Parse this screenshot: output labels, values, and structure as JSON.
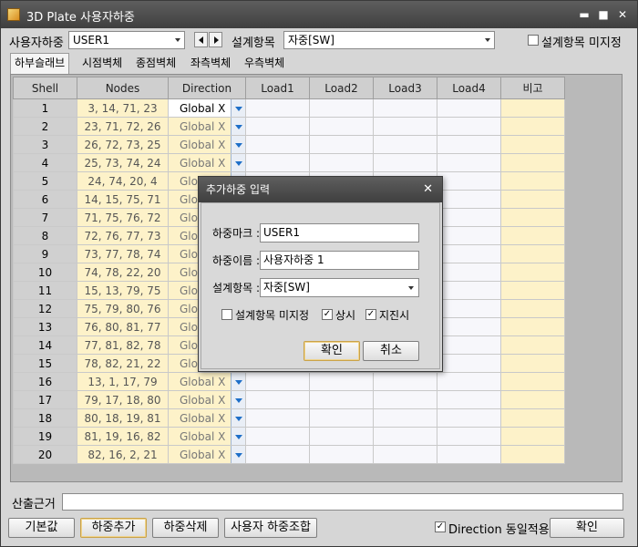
{
  "window": {
    "title": "3D Plate 사용자하중",
    "minimize": "▬",
    "maximize": "■",
    "close": "✕"
  },
  "toolbar": {
    "user_load_label": "사용자하중",
    "user_load_value": "USER1",
    "design_item_label": "설계항목",
    "design_item_value": "자중[SW]",
    "not_specified_label": "설계항목 미지정",
    "not_specified_checked": false
  },
  "tabs": [
    "하부슬래브",
    "시점벽체",
    "종점벽체",
    "좌측벽체",
    "우측벽체"
  ],
  "grid": {
    "columns": [
      "Shell",
      "Nodes",
      "Direction",
      "Load1",
      "Load2",
      "Load3",
      "Load4",
      "비고"
    ],
    "rows": [
      {
        "shell": "1",
        "nodes": "3, 14, 71, 23",
        "direction": "Global X"
      },
      {
        "shell": "2",
        "nodes": "23, 71, 72, 26",
        "direction": "Global X"
      },
      {
        "shell": "3",
        "nodes": "26, 72, 73, 25",
        "direction": "Global X"
      },
      {
        "shell": "4",
        "nodes": "25, 73, 74, 24",
        "direction": "Global X"
      },
      {
        "shell": "5",
        "nodes": "24, 74, 20,  4",
        "direction": "Glob"
      },
      {
        "shell": "6",
        "nodes": "14, 15, 75, 71",
        "direction": "Glob"
      },
      {
        "shell": "7",
        "nodes": "71, 75, 76, 72",
        "direction": "Glob"
      },
      {
        "shell": "8",
        "nodes": "72, 76, 77, 73",
        "direction": "Glob"
      },
      {
        "shell": "9",
        "nodes": "73, 77, 78, 74",
        "direction": "Glob"
      },
      {
        "shell": "10",
        "nodes": "74, 78, 22, 20",
        "direction": "Glob"
      },
      {
        "shell": "11",
        "nodes": "15, 13, 79, 75",
        "direction": "Glob"
      },
      {
        "shell": "12",
        "nodes": "75, 79, 80, 76",
        "direction": "Glob"
      },
      {
        "shell": "13",
        "nodes": "76, 80, 81, 77",
        "direction": "Glob"
      },
      {
        "shell": "14",
        "nodes": "77, 81, 82, 78",
        "direction": "Glob"
      },
      {
        "shell": "15",
        "nodes": "78, 82, 21, 22",
        "direction": "Glob"
      },
      {
        "shell": "16",
        "nodes": "13,  1, 17, 79",
        "direction": "Global X"
      },
      {
        "shell": "17",
        "nodes": "79, 17, 18, 80",
        "direction": "Global X"
      },
      {
        "shell": "18",
        "nodes": "80, 18, 19, 81",
        "direction": "Global X"
      },
      {
        "shell": "19",
        "nodes": "81, 19, 16, 82",
        "direction": "Global X"
      },
      {
        "shell": "20",
        "nodes": "82, 16,  2, 21",
        "direction": "Global X"
      }
    ]
  },
  "footer": {
    "basis_label": "산출근거",
    "basis_value": "",
    "default_button": "기본값",
    "add_load_button": "하중추가",
    "delete_load_button": "하중삭제",
    "combo_button": "사용자 하중조합",
    "direction_same_label": "Direction 동일적용",
    "direction_same_checked": true,
    "ok_button": "확인"
  },
  "dialog": {
    "title": "추가하중 입력",
    "close": "✕",
    "load_mark_label": "하중마크 :",
    "load_mark_value": "USER1",
    "load_name_label": "하중이름 :",
    "load_name_value": "사용자하중 1",
    "design_item_label": "설계항목 :",
    "design_item_value": "자중[SW]",
    "not_specified_label": "설계항목 미지정",
    "not_specified_checked": false,
    "normal_label": "상시",
    "normal_checked": true,
    "earthquake_label": "지진시",
    "earthquake_checked": true,
    "ok_button": "확인",
    "cancel_button": "취소"
  }
}
